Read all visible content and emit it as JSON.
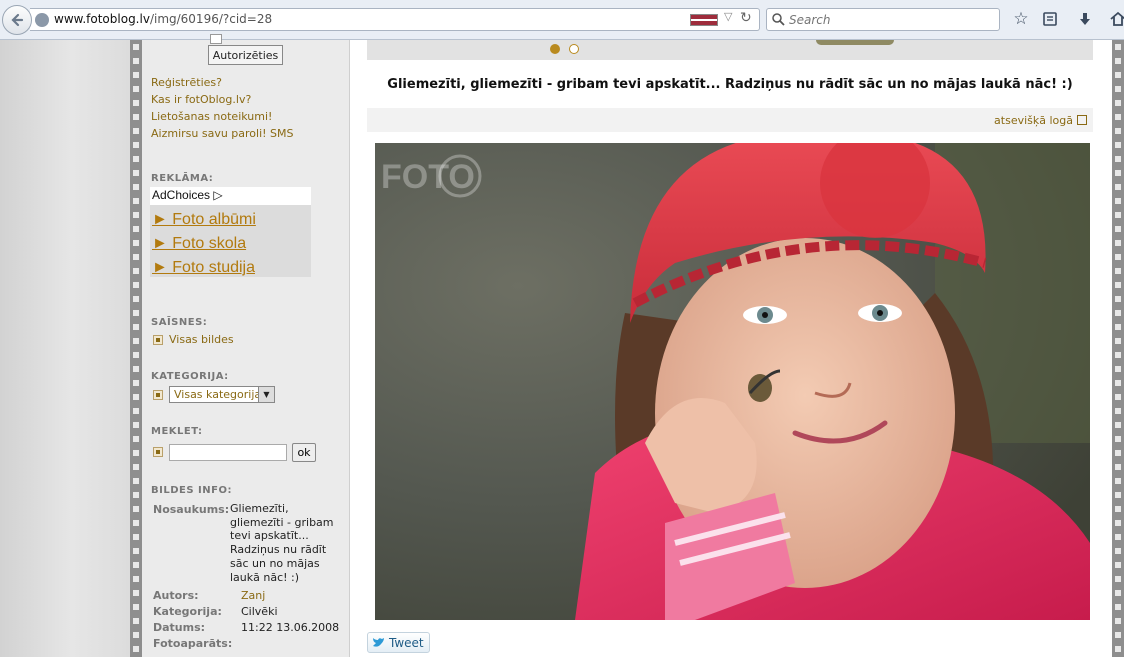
{
  "browser": {
    "url_host": "www.fotoblog.lv",
    "url_path": "/img/60196/?cid=28",
    "search_placeholder": "Search"
  },
  "sidebar": {
    "login_button": "Autorizēties",
    "links": [
      "Reģistrēties?",
      "Kas ir fotOblog.lv?",
      "Lietošanas noteikumi!",
      "Aizmirsu savu paroli! SMS"
    ],
    "ads": {
      "heading": "REKLĀMA:",
      "adchoices": "AdChoices",
      "items": [
        "► Foto albūmi",
        "► Foto skola",
        "► Foto studija"
      ]
    },
    "links_section": {
      "heading": "SAĪSNES:",
      "item": "Visas bildes"
    },
    "category": {
      "heading": "KATEGORIJA:",
      "selected": "Visas kategorijas"
    },
    "search": {
      "heading": "MEKLET:",
      "button": "ok"
    },
    "info": {
      "heading": "BILDES INFO:",
      "rows": [
        {
          "label": "Nosaukums:",
          "value": "Gliemezīti, gliemezīti - gribam tevi apskatīt... Radziņus nu rādīt sāc un no mājas laukā nāc! :)"
        },
        {
          "label": "Autors:",
          "value": "Zanj"
        },
        {
          "label": "Kategorija:",
          "value": "Cilvēki"
        },
        {
          "label": "Datums:",
          "value": "11:22 13.06.2008"
        },
        {
          "label": "Fotoaparāts:",
          "value": ""
        }
      ]
    }
  },
  "main": {
    "title": "Gliemezīti, gliemezīti - gribam tevi apskatīt... Radziņus nu rādīt sāc un no mājas laukā nāc! :)",
    "open_window_link": "atsevišķā logā",
    "photo_watermark": "FOTO",
    "tweet_button": "Tweet",
    "colors": {
      "accent": "#8a6a14",
      "photo_hat": "#e23a45",
      "photo_jacket": "#e5245a"
    }
  }
}
